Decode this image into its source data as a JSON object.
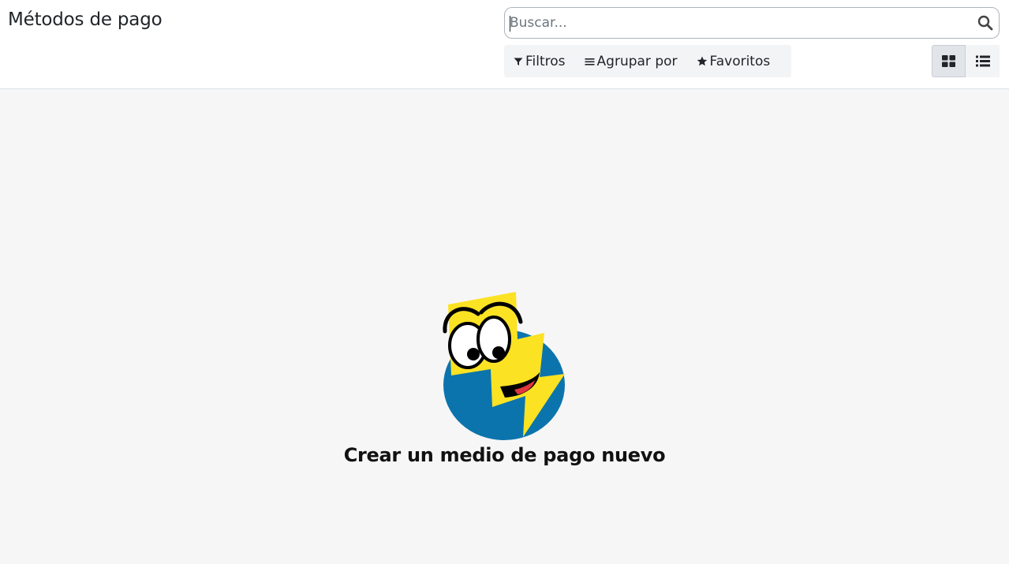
{
  "header": {
    "title": "Métodos de pago"
  },
  "search": {
    "placeholder": "Buscar..."
  },
  "filters": {
    "filters_label": "Filtros",
    "group_by_label": "Agrupar por",
    "favorites_label": "Favoritos"
  },
  "views": {
    "active": "kanban",
    "items": [
      "kanban",
      "list"
    ]
  },
  "helper": {
    "title": "Crear un medio de pago nuevo"
  },
  "colors": {
    "mascot_blue": "#0b74ad",
    "mascot_yellow": "#fbe223"
  }
}
